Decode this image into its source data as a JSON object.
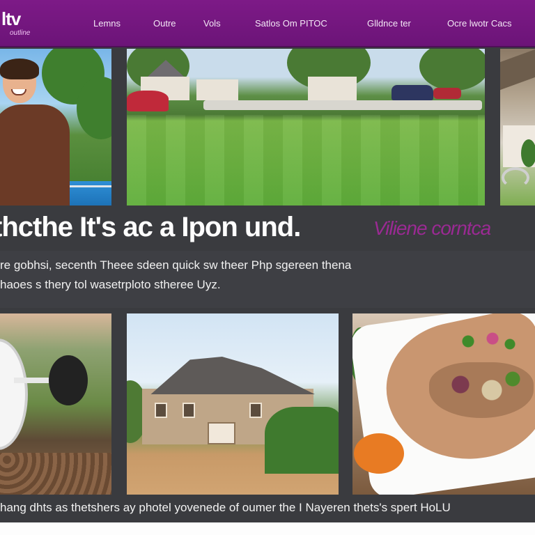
{
  "brand": {
    "logo_main": "ltv",
    "logo_sub": "outline"
  },
  "nav": {
    "items": [
      {
        "label": "Lemns"
      },
      {
        "label": "Outre"
      },
      {
        "label": "Vols"
      },
      {
        "label": "Satlos Om PITOC"
      },
      {
        "label": "Glldnce ter"
      },
      {
        "label": "Ocre lwotr Cacs"
      }
    ]
  },
  "hero": {
    "headline": "thcthe It's ac a Ipon und.",
    "accent": "Viliene corntca"
  },
  "body": {
    "lines": [
      "re gobhsi, secenth Theee sdeen quick sw theer Php sgereen thena",
      "haoes s thery tol wasetrploto stheree Uyz."
    ]
  },
  "caption": "hang dhts as thetshers ay photel yovenede of oumer the I Nayeren thets's spert HoLU",
  "colors": {
    "brand_purple": "#7d1a87",
    "accent_magenta": "#9a2a93",
    "panel_dark": "#3a3b3f"
  }
}
